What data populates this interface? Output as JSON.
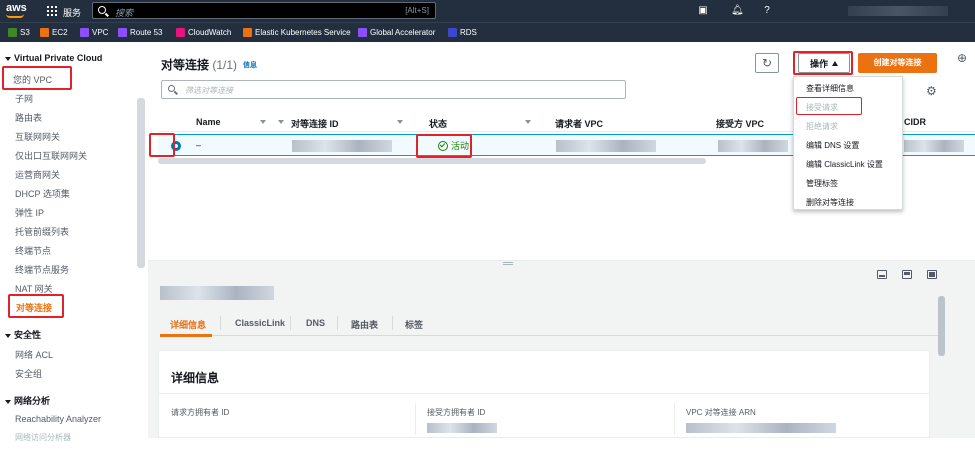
{
  "topbar": {
    "logo": "aws",
    "services_label": "服务",
    "search_placeholder": "搜索",
    "search_shortcut": "[Alt+S]"
  },
  "favorites": [
    {
      "label": "S3",
      "color": "#3f8624"
    },
    {
      "label": "EC2",
      "color": "#ec7211"
    },
    {
      "label": "VPC",
      "color": "#8c4fff"
    },
    {
      "label": "Route 53",
      "color": "#8c4fff"
    },
    {
      "label": "CloudWatch",
      "color": "#e7157b"
    },
    {
      "label": "Elastic Kubernetes Service",
      "color": "#ec7211"
    },
    {
      "label": "Global Accelerator",
      "color": "#8c4fff"
    },
    {
      "label": "RDS",
      "color": "#3b48cc"
    }
  ],
  "sidebar": {
    "section_vpc": "Virtual Private Cloud",
    "items_vpc": [
      "您的 VPC",
      "子网",
      "路由表",
      "互联网网关",
      "仅出口互联网网关",
      "运营商网关",
      "DHCP 选项集",
      "弹性 IP",
      "托管前缀列表",
      "终端节点",
      "终端节点服务",
      "NAT 网关",
      "对等连接"
    ],
    "section_security": "安全性",
    "items_security": [
      "网络 ACL",
      "安全组"
    ],
    "section_analysis": "网络分析",
    "items_analysis": [
      "Reachability Analyzer",
      "网络访问分析器"
    ]
  },
  "panel": {
    "title": "对等连接",
    "count": "(1/1)",
    "info": "信息",
    "actions_label": "操作",
    "create_label": "创建对等连接",
    "filter_placeholder": "筛选对等连接"
  },
  "table": {
    "columns": [
      "Name",
      "对等连接 ID",
      "状态",
      "请求者 VPC",
      "接受方 VPC",
      "CIDR"
    ],
    "row": {
      "name": "–",
      "status": "活动"
    }
  },
  "actions_menu": [
    "查看详细信息",
    "接受请求",
    "拒绝请求",
    "编辑 DNS 设置",
    "编辑 ClassicLink 设置",
    "管理标签",
    "删除对等连接"
  ],
  "details": {
    "tabs": [
      "详细信息",
      "ClassicLink",
      "DNS",
      "路由表",
      "标签"
    ],
    "card_title": "详细信息",
    "fields": [
      "请求方拥有者 ID",
      "接受方拥有者 ID",
      "VPC 对等连接 ARN"
    ]
  },
  "colors": {
    "accent": "#ec7211",
    "highlight": "#e0222a",
    "selected": "#0073bb",
    "active_status": "#1d8102"
  }
}
